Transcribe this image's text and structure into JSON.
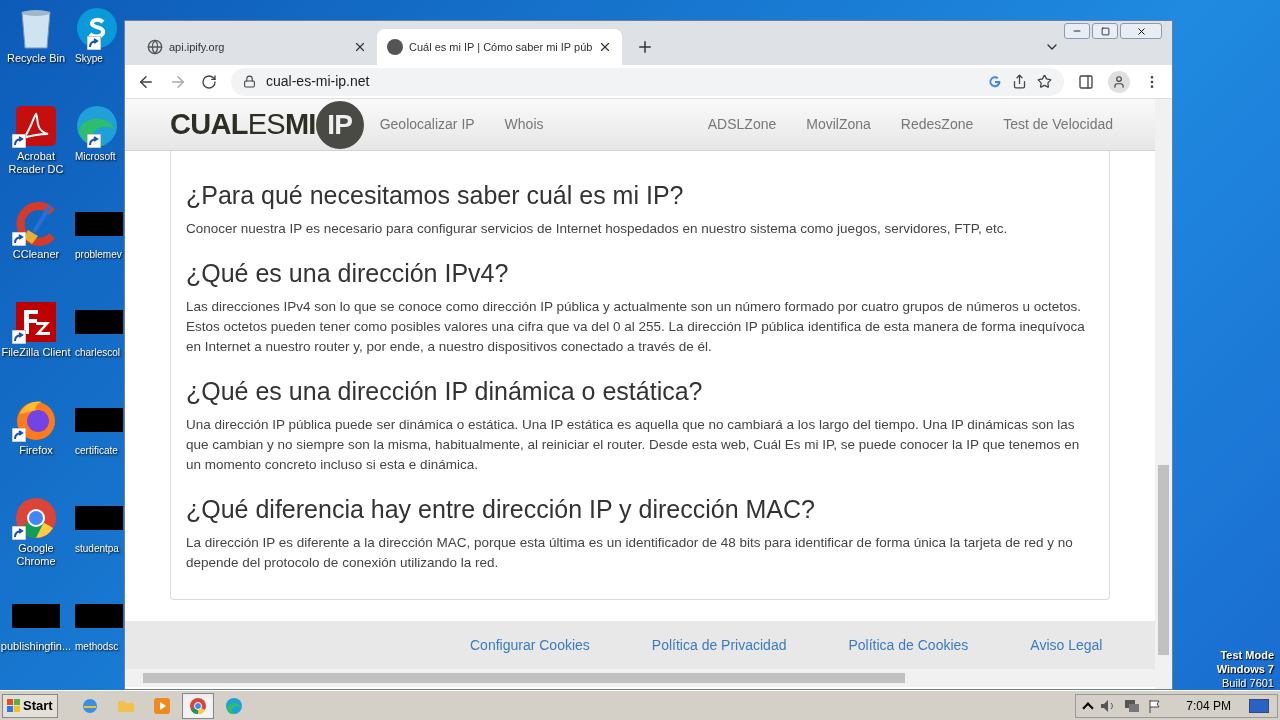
{
  "desktop_icons": [
    {
      "label": "Recycle Bin",
      "shortcut": false
    },
    {
      "label": "Skype",
      "shortcut": true
    },
    {
      "label": "Acrobat Reader DC",
      "shortcut": true
    },
    {
      "label": "Microsoft",
      "shortcut": true
    },
    {
      "label": "CCleaner",
      "shortcut": true
    },
    {
      "label": "problemev",
      "shortcut": false
    },
    {
      "label": "FileZilla Client",
      "shortcut": true
    },
    {
      "label": "charlescol",
      "shortcut": false
    },
    {
      "label": "Firefox",
      "shortcut": true
    },
    {
      "label": "certificate",
      "shortcut": false
    },
    {
      "label": "Google Chrome",
      "shortcut": true
    },
    {
      "label": "studentpa",
      "shortcut": false
    },
    {
      "label": "publishingfin...",
      "shortcut": false
    },
    {
      "label": "methodsc",
      "shortcut": false
    }
  ],
  "browser": {
    "tabs": [
      {
        "title": "api.ipify.org",
        "selected": false
      },
      {
        "title": "Cuál es mi IP | Cómo saber mi IP púb",
        "selected": true
      }
    ],
    "address": "cual-es-mi-ip.net"
  },
  "site": {
    "logo": [
      "CUAL",
      "ES",
      "MI",
      "IP"
    ],
    "nav_left": [
      "Geolocalizar IP",
      "Whois"
    ],
    "nav_right": [
      "ADSLZone",
      "MovilZona",
      "RedesZone",
      "Test de Velocidad"
    ],
    "sections": [
      {
        "heading": "¿Para qué necesitamos saber cuál es mi IP?",
        "body": "Conocer nuestra IP es necesario para configurar servicios de Internet hospedados en nuestro sistema como juegos, servidores, FTP, etc."
      },
      {
        "heading": "¿Qué es una dirección IPv4?",
        "body": "Las direcciones IPv4 son lo que se conoce como dirección IP pública y actualmente son un número formado por cuatro grupos de números u octetos. Estos octetos pueden tener como posibles valores una cifra que va del 0 al 255. La dirección IP pública identifica de esta manera de forma inequívoca en Internet a nuestro router y, por ende, a nuestro dispositivos conectado a través de él."
      },
      {
        "heading": "¿Qué es una dirección IP dinámica o estática?",
        "body": "Una dirección IP pública puede ser dinámica o estática. Una IP estática es aquella que no cambiará a los largo del tiempo. Una IP dinámicas son las que cambian y no siempre son la misma, habitualmente, al reiniciar el router. Desde esta web, Cuál Es mi IP, se puede conocer la IP que tenemos en un momento concreto incluso si esta e dinámica."
      },
      {
        "heading": "¿Qué diferencia hay entre dirección IP y dirección MAC?",
        "body": "La dirección IP es diferente a la dirección MAC, porque esta última es un identificador de 48 bits para identificar de forma única la tarjeta de red y no depende del protocolo de conexión utilizando la red."
      }
    ],
    "footer_links": [
      "Configurar Cookies",
      "Política de Privacidad",
      "Política de Cookies",
      "Aviso Legal"
    ]
  },
  "os_notice": [
    "Test Mode",
    "Windows 7",
    "Build 7601"
  ],
  "taskbar": {
    "start": "Start",
    "apps": [
      {
        "selected": false
      },
      {
        "selected": false
      },
      {
        "selected": false
      },
      {
        "selected": true
      },
      {
        "selected": false
      }
    ],
    "clock": "7:04 PM"
  }
}
